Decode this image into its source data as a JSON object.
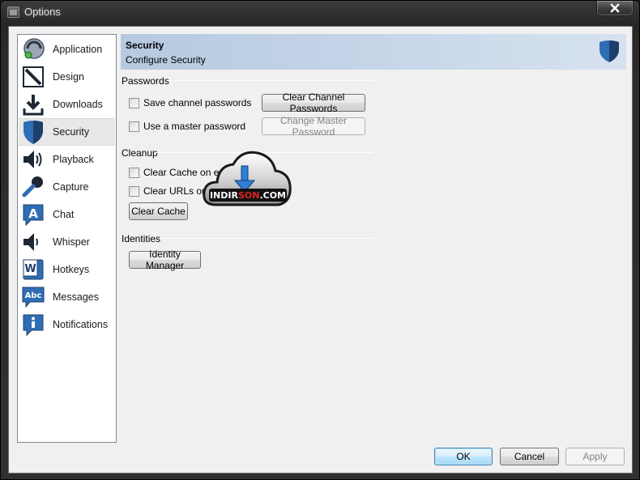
{
  "window": {
    "title": "Options"
  },
  "sidebar": {
    "items": [
      {
        "label": "Application",
        "icon": "application-icon"
      },
      {
        "label": "Design",
        "icon": "design-icon"
      },
      {
        "label": "Downloads",
        "icon": "downloads-icon"
      },
      {
        "label": "Security",
        "icon": "shield-icon",
        "selected": true
      },
      {
        "label": "Playback",
        "icon": "speaker-icon"
      },
      {
        "label": "Capture",
        "icon": "microphone-icon"
      },
      {
        "label": "Chat",
        "icon": "chat-icon"
      },
      {
        "label": "Whisper",
        "icon": "whisper-icon"
      },
      {
        "label": "Hotkeys",
        "icon": "hotkeys-icon"
      },
      {
        "label": "Messages",
        "icon": "messages-icon"
      },
      {
        "label": "Notifications",
        "icon": "info-icon"
      }
    ]
  },
  "header": {
    "title": "Security",
    "subtitle": "Configure Security"
  },
  "passwords": {
    "title": "Passwords",
    "save_label": "Save channel passwords",
    "master_label": "Use a master password",
    "clear_button": "Clear Channel Passwords",
    "change_button": "Change Master Password"
  },
  "cleanup": {
    "title": "Cleanup",
    "cache_label": "Clear Cache on exit",
    "urls_label": "Clear URLs on exit",
    "clear_cache_button": "Clear Cache"
  },
  "identities": {
    "title": "Identities",
    "manager_button": "Identity Manager"
  },
  "footer": {
    "ok": "OK",
    "cancel": "Cancel",
    "apply": "Apply"
  },
  "watermark": {
    "text_a": "INDIR",
    "text_b": "SON",
    "text_c": ".COM"
  },
  "colors": {
    "accent_blue": "#2f6db5",
    "header_bg": "#c9d8ea",
    "watermark_red": "#e02020"
  }
}
